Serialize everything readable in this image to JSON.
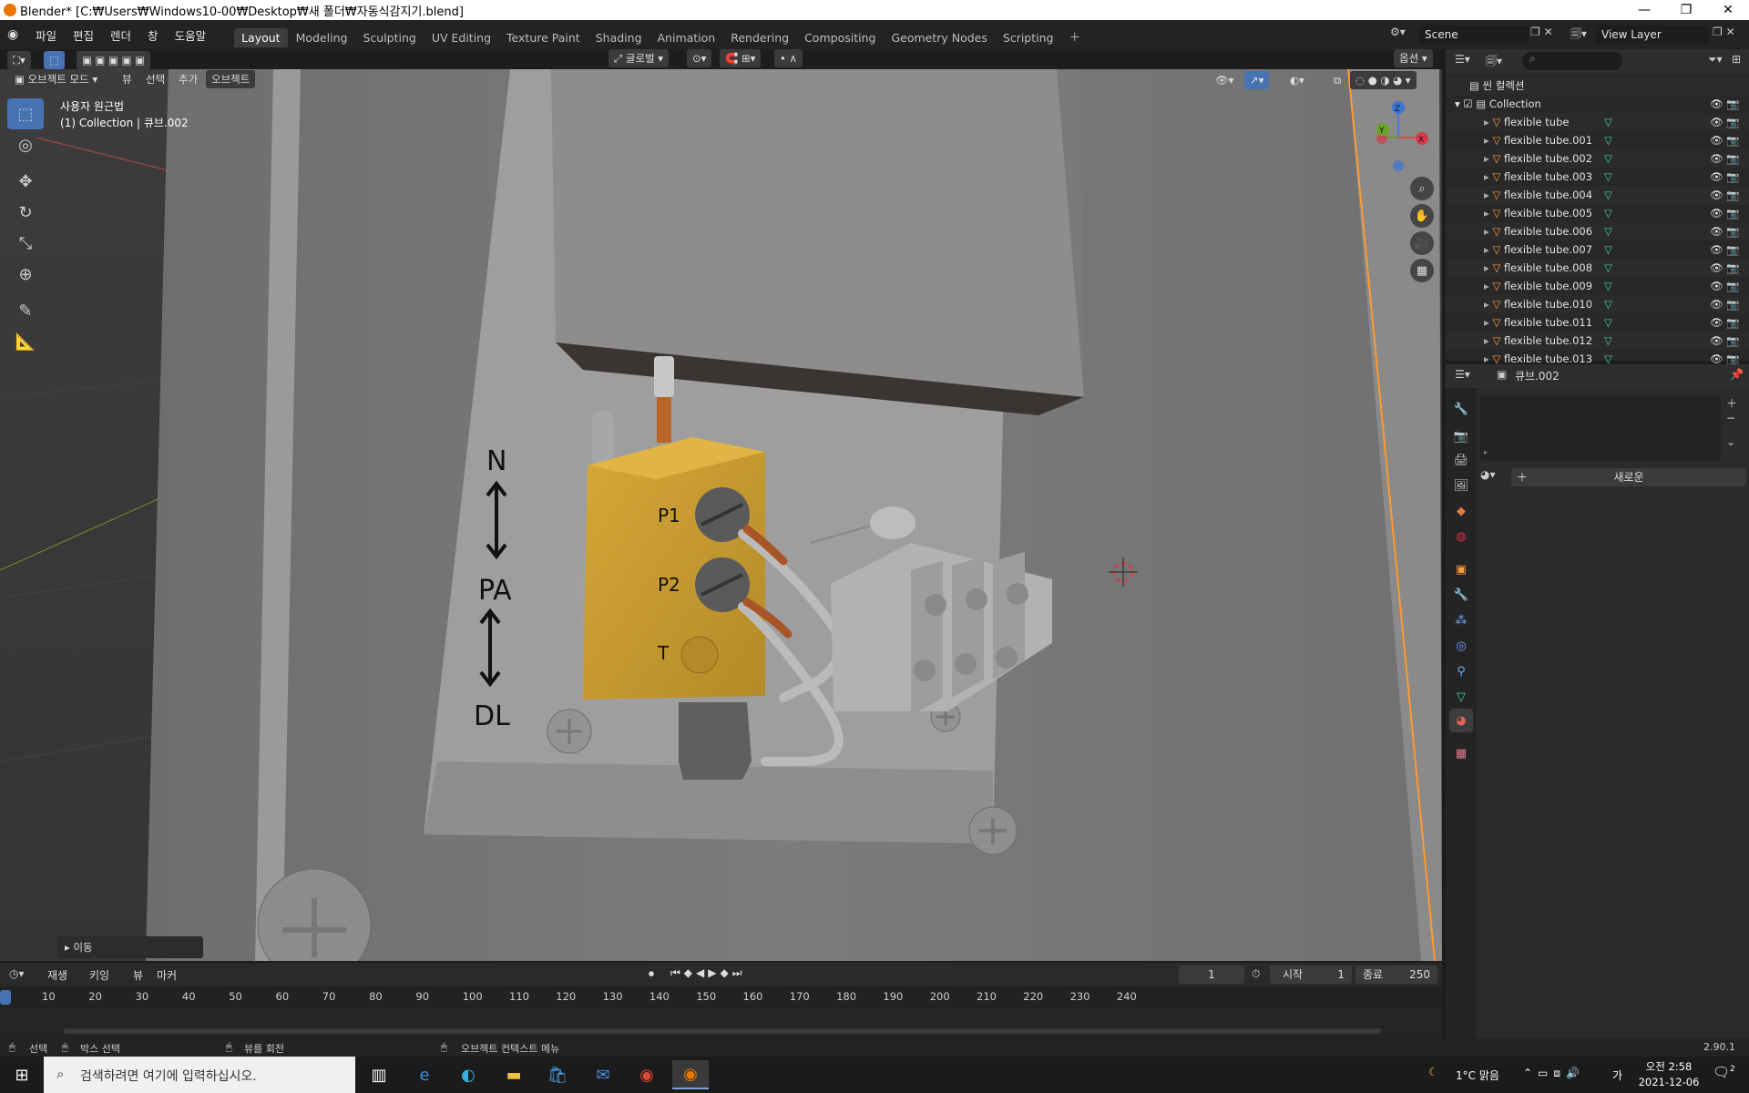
{
  "window": {
    "title": "Blender* [C:₩Users₩Windows10-00₩Desktop₩새 폴더₩자동식감지기.blend]",
    "minimize": "—",
    "restore": "❐",
    "close": "✕"
  },
  "menus": [
    "파일",
    "편집",
    "렌더",
    "창",
    "도움말"
  ],
  "workspaces": [
    "Layout",
    "Modeling",
    "Sculpting",
    "UV Editing",
    "Texture Paint",
    "Shading",
    "Animation",
    "Rendering",
    "Compositing",
    "Geometry Nodes",
    "Scripting"
  ],
  "active_workspace": "Layout",
  "scene_name": "Scene",
  "view_layer": "View Layer",
  "viewport_header": {
    "mode": "오브젝트 모드",
    "menus": [
      "뷰",
      "선택",
      "추가",
      "오브젝트"
    ],
    "transform_orientation": "글로벌",
    "options": "옵션"
  },
  "viewport": {
    "view_name": "사용자 원근법",
    "collection_info": "(1) Collection | 큐브.002",
    "operator_panel": "이동",
    "axis_labels": {
      "z": "Z",
      "x": "X",
      "y": "Y"
    },
    "panel_labels": {
      "n": "N",
      "pa": "PA",
      "dl": "DL",
      "p1": "P1",
      "p2": "P2",
      "t": "T"
    }
  },
  "outliner": {
    "scene_collection": "씬 컬렉션",
    "collection": "Collection",
    "items": [
      "flexible tube",
      "flexible tube.001",
      "flexible tube.002",
      "flexible tube.003",
      "flexible tube.004",
      "flexible tube.005",
      "flexible tube.006",
      "flexible tube.007",
      "flexible tube.008",
      "flexible tube.009",
      "flexible tube.010",
      "flexible tube.011",
      "flexible tube.012",
      "flexible tube.013"
    ]
  },
  "properties": {
    "object_name": "큐브.002",
    "new_button": "새로운"
  },
  "timeline": {
    "menus": [
      "재생",
      "키잉",
      "뷰",
      "마커"
    ],
    "current_frame": "1",
    "start_label": "시작",
    "start": "1",
    "end_label": "종료",
    "end": "250",
    "ticks": [
      "10",
      "20",
      "30",
      "40",
      "50",
      "60",
      "70",
      "80",
      "90",
      "100",
      "110",
      "120",
      "130",
      "140",
      "150",
      "160",
      "170",
      "180",
      "190",
      "200",
      "210",
      "220",
      "230",
      "240"
    ]
  },
  "statusbar": {
    "select": "선택",
    "box_select": "박스 선택",
    "rotate_view": "뷰를 회전",
    "context_menu": "오브젝트 컨텍스트 메뉴",
    "version": "2.90.1"
  },
  "taskbar": {
    "search_placeholder": "검색하려면 여기에 입력하십시오.",
    "weather": "1°C 맑음",
    "ime": "가",
    "time": "오전 2:58",
    "date": "2021-12-06",
    "notifications": "2"
  },
  "colors": {
    "accent": "#4772b3",
    "active_tab": "#3d3d3d",
    "mesh_icon": "#ff9b3d",
    "data_icon": "#43d49a",
    "brass": "#c89a2e"
  }
}
